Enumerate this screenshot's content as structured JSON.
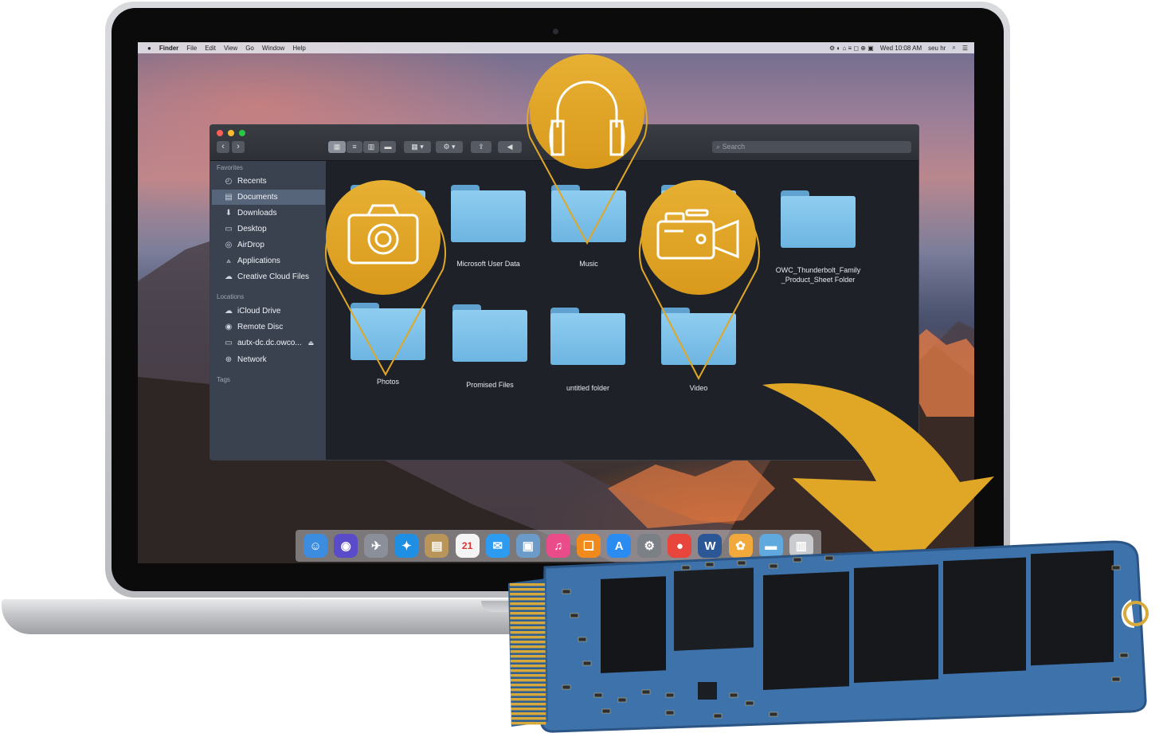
{
  "menubar": {
    "items": [
      "Finder",
      "File",
      "Edit",
      "View",
      "Go",
      "Window",
      "Help"
    ],
    "status_text": "Wed 10:08 AM",
    "user": "seu hr"
  },
  "finder": {
    "search_placeholder": "Search",
    "sidebar": {
      "favorites_heading": "Favorites",
      "favorites": [
        {
          "label": "Recents",
          "icon": "clock-icon"
        },
        {
          "label": "Documents",
          "icon": "document-icon",
          "selected": true
        },
        {
          "label": "Downloads",
          "icon": "download-icon"
        },
        {
          "label": "Desktop",
          "icon": "desktop-icon"
        },
        {
          "label": "AirDrop",
          "icon": "airdrop-icon"
        },
        {
          "label": "Applications",
          "icon": "applications-icon"
        },
        {
          "label": "Creative Cloud Files",
          "icon": "creative-cloud-icon"
        }
      ],
      "locations_heading": "Locations",
      "locations": [
        {
          "label": "iCloud Drive",
          "icon": "cloud-icon"
        },
        {
          "label": "Remote Disc",
          "icon": "disc-icon"
        },
        {
          "label": "autx-dc.dc.owco...",
          "icon": "server-icon"
        },
        {
          "label": "Network",
          "icon": "globe-icon"
        }
      ],
      "tags_heading": "Tags"
    },
    "folders": [
      {
        "label": "",
        "row": 0
      },
      {
        "label": "Microsoft User Data",
        "row": 0
      },
      {
        "label": "Music",
        "row": 0
      },
      {
        "label": "",
        "row": 0
      },
      {
        "label": "OWC_Thunderbolt_Family _Product_Sheet Folder",
        "row": 0
      },
      {
        "label": "Photos",
        "row": 1
      },
      {
        "label": "Promised Files",
        "row": 1
      },
      {
        "label": "untitled folder",
        "row": 1
      },
      {
        "label": "Video",
        "row": 1
      }
    ]
  },
  "pins": [
    {
      "name": "camera-pin",
      "icon": "camera-icon"
    },
    {
      "name": "headphones-pin",
      "icon": "headphones-icon"
    },
    {
      "name": "video-camera-pin",
      "icon": "video-camera-icon"
    }
  ],
  "dock": {
    "apps": [
      {
        "name": "finder",
        "color": "#3c8de0",
        "glyph": "☺"
      },
      {
        "name": "siri",
        "color": "#5a4cc9",
        "glyph": "◉"
      },
      {
        "name": "launchpad",
        "color": "#8a8f99",
        "glyph": "✈"
      },
      {
        "name": "safari",
        "color": "#1f8fe3",
        "glyph": "✦"
      },
      {
        "name": "contacts",
        "color": "#b9955a",
        "glyph": "▤"
      },
      {
        "name": "calendar",
        "color": "#f4f4f4",
        "glyph": "21"
      },
      {
        "name": "messages",
        "color": "#2d9bf0",
        "glyph": "✉"
      },
      {
        "name": "preview",
        "color": "#6b9bc9",
        "glyph": "▣"
      },
      {
        "name": "itunes",
        "color": "#ea4c89",
        "glyph": "♫"
      },
      {
        "name": "ibooks",
        "color": "#f08a1c",
        "glyph": "❑"
      },
      {
        "name": "app-store",
        "color": "#2a8cf0",
        "glyph": "A"
      },
      {
        "name": "system-preferences",
        "color": "#7b7f86",
        "glyph": "⚙"
      },
      {
        "name": "chrome",
        "color": "#e8453c",
        "glyph": "●"
      },
      {
        "name": "word",
        "color": "#2b5797",
        "glyph": "W"
      },
      {
        "name": "photos",
        "color": "#f2a93b",
        "glyph": "✿"
      },
      {
        "name": "folder",
        "color": "#5fa9de",
        "glyph": "▬"
      },
      {
        "name": "trash",
        "color": "#c9cbce",
        "glyph": "▥"
      }
    ]
  },
  "colors": {
    "accent_gold": "#e0a727",
    "ssd_board": "#3b6fa8",
    "ssd_chip": "#141619",
    "gold_contacts": "#d6a93a"
  }
}
